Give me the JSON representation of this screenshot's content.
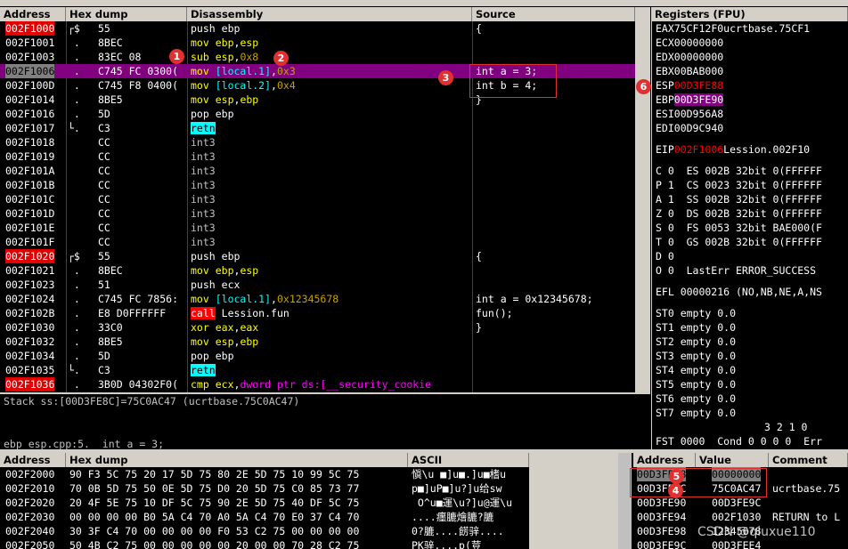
{
  "headers": {
    "address": "Address",
    "hex": "Hex dump",
    "disasm": "Disassembly",
    "source": "Source",
    "registers": "Registers (FPU)",
    "dump_address": "Address",
    "dump_hex": "Hex dump",
    "dump_ascii": "ASCII",
    "stack_address": "Address",
    "stack_value": "Value",
    "stack_comment": "Comment"
  },
  "cpu_rows": [
    {
      "addr": "002F1000",
      "bracket": "┌$",
      "hex": "55",
      "dis": "push ebp",
      "src": "{"
    },
    {
      "addr": "002F1001",
      "bracket": " .",
      "hex": "8BEC",
      "dis": "mov ebp,esp",
      "src": ""
    },
    {
      "addr": "002F1003",
      "bracket": " .",
      "hex": "83EC 08",
      "dis": "sub esp,0x8",
      "src": ""
    },
    {
      "addr": "002F1006",
      "bracket": " .",
      "hex": "C745 FC 0300(",
      "dis": "mov [local.1],0x3",
      "src": "int a = 3;"
    },
    {
      "addr": "002F100D",
      "bracket": " .",
      "hex": "C745 F8 0400(",
      "dis": "mov [local.2],0x4",
      "src": "int b = 4;"
    },
    {
      "addr": "002F1014",
      "bracket": " .",
      "hex": "8BE5",
      "dis": "mov esp,ebp",
      "src": "}"
    },
    {
      "addr": "002F1016",
      "bracket": " .",
      "hex": "5D",
      "dis": "pop ebp",
      "src": ""
    },
    {
      "addr": "002F1017",
      "bracket": "└.",
      "hex": "C3",
      "dis": "retn",
      "src": ""
    },
    {
      "addr": "002F1018",
      "bracket": "",
      "hex": "CC",
      "dis": "int3",
      "src": ""
    },
    {
      "addr": "002F1019",
      "bracket": "",
      "hex": "CC",
      "dis": "int3",
      "src": ""
    },
    {
      "addr": "002F101A",
      "bracket": "",
      "hex": "CC",
      "dis": "int3",
      "src": ""
    },
    {
      "addr": "002F101B",
      "bracket": "",
      "hex": "CC",
      "dis": "int3",
      "src": ""
    },
    {
      "addr": "002F101C",
      "bracket": "",
      "hex": "CC",
      "dis": "int3",
      "src": ""
    },
    {
      "addr": "002F101D",
      "bracket": "",
      "hex": "CC",
      "dis": "int3",
      "src": ""
    },
    {
      "addr": "002F101E",
      "bracket": "",
      "hex": "CC",
      "dis": "int3",
      "src": ""
    },
    {
      "addr": "002F101F",
      "bracket": "",
      "hex": "CC",
      "dis": "int3",
      "src": ""
    },
    {
      "addr": "002F1020",
      "bracket": "┌$",
      "hex": "55",
      "dis": "push ebp",
      "src": "{"
    },
    {
      "addr": "002F1021",
      "bracket": " .",
      "hex": "8BEC",
      "dis": "mov ebp,esp",
      "src": ""
    },
    {
      "addr": "002F1023",
      "bracket": " .",
      "hex": "51",
      "dis": "push ecx",
      "src": ""
    },
    {
      "addr": "002F1024",
      "bracket": " .",
      "hex": "C745 FC 7856:",
      "dis": "mov [local.1],0x12345678",
      "src": "int a = 0x12345678;"
    },
    {
      "addr": "002F102B",
      "bracket": " .",
      "hex": "E8 D0FFFFFF",
      "dis": "call Lession.fun",
      "src": "fun();"
    },
    {
      "addr": "002F1030",
      "bracket": " .",
      "hex": "33C0",
      "dis": "xor eax,eax",
      "src": "}"
    },
    {
      "addr": "002F1032",
      "bracket": " .",
      "hex": "8BE5",
      "dis": "mov esp,ebp",
      "src": ""
    },
    {
      "addr": "002F1034",
      "bracket": " .",
      "hex": "5D",
      "dis": "pop ebp",
      "src": ""
    },
    {
      "addr": "002F1035",
      "bracket": "└.",
      "hex": "C3",
      "dis": "retn",
      "src": ""
    },
    {
      "addr": "002F1036",
      "bracket": " .",
      "hex": "3B0D 04302F0(",
      "dis": "cmp ecx,dword ptr ds:[__security_cookie",
      "src": ""
    }
  ],
  "info_lines": [
    "Stack ss:[00D3FE8C]=75C0AC47 (ucrtbase.75C0AC47)",
    "",
    "ebp_esp.cpp:5.  int a = 3;"
  ],
  "registers": [
    {
      "name": "EAX",
      "val": "75CF12F0",
      "note": "ucrtbase.75CF1"
    },
    {
      "name": "ECX",
      "val": "00000000",
      "note": ""
    },
    {
      "name": "EDX",
      "val": "00000000",
      "note": ""
    },
    {
      "name": "EBX",
      "val": "00BAB000",
      "note": ""
    },
    {
      "name": "ESP",
      "val": "00D3FE88",
      "note": ""
    },
    {
      "name": "EBP",
      "val": "00D3FE90",
      "note": ""
    },
    {
      "name": "ESI",
      "val": "00D956A8",
      "note": ""
    },
    {
      "name": "EDI",
      "val": "00D9C940",
      "note": ""
    },
    {
      "name": "EIP",
      "val": "002F1006",
      "note": "Lession.002F10"
    }
  ],
  "flags": [
    "C 0  ES 002B 32bit 0(FFFFFF",
    "P 1  CS 0023 32bit 0(FFFFFF",
    "A 1  SS 002B 32bit 0(FFFFFF",
    "Z 0  DS 002B 32bit 0(FFFFFF",
    "S 0  FS 0053 32bit BAE000(F",
    "T 0  GS 002B 32bit 0(FFFFFF",
    "D 0",
    "O 0  LastErr ERROR_SUCCESS"
  ],
  "efl": "EFL 00000216 (NO,NB,NE,A,NS",
  "fpu": [
    "ST0 empty 0.0",
    "ST1 empty 0.0",
    "ST2 empty 0.0",
    "ST3 empty 0.0",
    "ST4 empty 0.0",
    "ST5 empty 0.0",
    "ST6 empty 0.0",
    "ST7 empty 0.0"
  ],
  "fst_bits": "3 2 1 0",
  "fst": "FST 0000  Cond 0 0 0 0  Err",
  "dump_rows": [
    {
      "addr": "002F2000",
      "hex": "90 F3 5C 75 20 17 5D 75 80 2E 5D 75 10 99 5C 75",
      "ascii": "愼\\u ■]u■.]u■榰u"
    },
    {
      "addr": "002F2010",
      "hex": "70 0B 5D 75 50 0E 5D 75 D0 20 5D 75 C0 85 73 77",
      "ascii": "p■]uP■]u?]u给sw"
    },
    {
      "addr": "002F2020",
      "hex": "20 4F 5E 75 10 DF 5C 75 90 2E 5D 75 40 DF 5C 75",
      "ascii": " O^u■運\\u?]u@運\\u"
    },
    {
      "addr": "002F2030",
      "hex": "00 00 00 00 B0 5A C4 70 A0 5A C4 70 E0 37 C4 70",
      "ascii": "....癦膔燴膔?膔"
    },
    {
      "addr": "002F2040",
      "hex": "30 3F C4 70 00 00 00 00 F0 53 C2 75 00 00 00 00",
      "ascii": "0?膔....餝骍...."
    },
    {
      "addr": "002F2050",
      "hex": "50 4B C2 75 00 00 00 00 00 20 00 00 70 28 C2 75",
      "ascii": "PK骍....p(荳"
    }
  ],
  "stack_rows": [
    {
      "addr": "00D3FE88",
      "val": "00000000",
      "comment": ""
    },
    {
      "addr": "00D3FE8C",
      "val": "75C0AC47",
      "comment": "ucrtbase.75"
    },
    {
      "addr": "00D3FE90",
      "val": "00D3FE9C",
      "comment": ""
    },
    {
      "addr": "00D3FE94",
      "val": "002F1030",
      "comment": "RETURN to L"
    },
    {
      "addr": "00D3FE98",
      "val": "12345678",
      "comment": ""
    },
    {
      "addr": "00D3FE9C",
      "val": "00D3FEE4",
      "comment": ""
    }
  ],
  "badges": [
    "1",
    "2",
    "3",
    "4",
    "5",
    "6"
  ],
  "watermark": "CSDN @qiuxue110"
}
